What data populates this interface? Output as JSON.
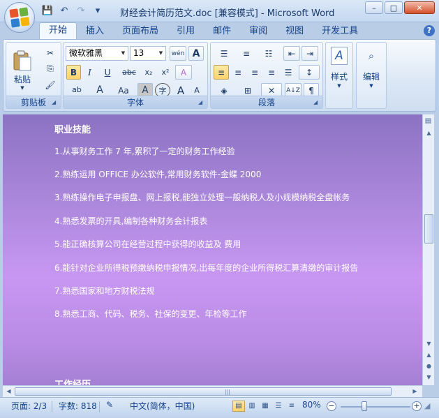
{
  "window": {
    "title": "财经会计简历范文.doc [兼容模式] - Microsoft Word",
    "controls": {
      "minimize": "–",
      "maximize": "□",
      "close": "✕"
    }
  },
  "qat": {
    "save_icon": "💾",
    "undo_icon": "↶",
    "redo_icon": "↷",
    "customize_icon": "▾"
  },
  "tabs": [
    {
      "label": "开始",
      "active": true
    },
    {
      "label": "插入"
    },
    {
      "label": "页面布局"
    },
    {
      "label": "引用"
    },
    {
      "label": "邮件"
    },
    {
      "label": "审阅"
    },
    {
      "label": "视图"
    },
    {
      "label": "开发工具"
    }
  ],
  "help": "?",
  "ribbon": {
    "clipboard": {
      "label": "剪贴板",
      "paste": "粘贴",
      "cut_icon": "✂",
      "copy_icon": "⎘",
      "format_painter_icon": "🖌"
    },
    "font": {
      "label": "字体",
      "font_name": "微软雅黑",
      "font_size": "13",
      "phonetic": "wén",
      "border_char": "A",
      "bold": "B",
      "italic": "I",
      "underline": "U",
      "strike": "abc",
      "subscript": "x₂",
      "superscript": "x²",
      "clear_format": "A",
      "highlight": "ab",
      "font_color": "A",
      "change_case": "Aa",
      "char_shading": "A",
      "enclosed": "字",
      "grow": "A",
      "shrink": "A"
    },
    "paragraph": {
      "label": "段落",
      "bullets_icon": "☰",
      "numbering_icon": "≡",
      "multilevel_icon": "☷",
      "decrease_indent_icon": "⇤",
      "increase_indent_icon": "⇥",
      "align_left_icon": "≡",
      "center_icon": "≡",
      "align_right_icon": "≡",
      "justify_icon": "≡",
      "distributed_icon": "☰",
      "line_spacing_icon": "↕",
      "shading_icon": "◈",
      "borders_icon": "⊞",
      "chinese_layout_icon": "✕",
      "sort_icon": "A↓Z",
      "show_marks_icon": "¶"
    },
    "styles": {
      "label": "样式"
    },
    "editing": {
      "label": "编辑"
    }
  },
  "document": {
    "lines": [
      "职业技能",
      "1.从事财务工作 7 年,累积了一定的财务工作经验",
      "2.熟练运用 OFFICE 办公软件,常用财务软件-金蝶 2000",
      "3.熟练操作电子申报盘、网上报税,能独立处理一般纳税人及小规模纳税全盘帐务",
      "4.熟悉发票的开具,编制各种财务会计报表",
      "5.能正确核算公司在经营过程中获得的收益及 费用",
      "6.能针对企业所得税预缴纳税申报情况,出每年度的企业所得税汇算清缴的审计报告",
      "7.熟悉国家和地方财税法规",
      "8.熟悉工商、代码、税务、社保的变更、年检等工作",
      "工作经历"
    ]
  },
  "statusbar": {
    "page": "页面: 2/3",
    "words": "字数: 818",
    "language": "中文(简体，中国)",
    "zoom": "80%",
    "zoom_level": 0.8
  }
}
